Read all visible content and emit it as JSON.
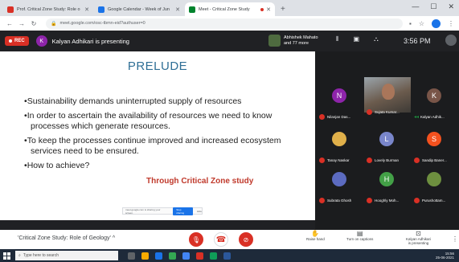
{
  "browser": {
    "tabs": [
      {
        "label": "Prof. Critical Zone Study: Role o",
        "favicon_color": "#d93025",
        "active": false
      },
      {
        "label": "Google Calendar - Week of Jun",
        "favicon_color": "#1a73e8",
        "active": false
      },
      {
        "label": "Meet - Critical Zone Study",
        "favicon_color": "#00832d",
        "active": true
      }
    ],
    "new_tab": "+",
    "url": "meet.google.com/osc-tbmn-eid?authuser=0",
    "window_controls": [
      "—",
      "☐",
      "✕"
    ]
  },
  "meet_bar": {
    "rec_label": "REC",
    "presenter_initial": "K",
    "presenting_text": "Kalyan Adhikari is presenting",
    "participants_line1": "Abhishek Mahato",
    "participants_line2": "and 77 more",
    "time": "3:56 PM",
    "you_label": "You"
  },
  "slide": {
    "title": "PRELUDE",
    "bullets": [
      "Sustainability demands uninterrupted supply of resources",
      "In order to ascertain the availability of resources we need to know processes which generate resources.",
      "To keep the processes continue improved and increased ecosystem services need to be ensured.",
      "How to achieve?"
    ],
    "subtitle": "Through Critical Zone study",
    "share_notice": "meet.google.com is sharing your screen.",
    "share_stop": "Stop sharing",
    "share_hide": "Hide"
  },
  "tiles": [
    {
      "name": "Nilanjan Das...",
      "initial": "N",
      "color": "#8e24aa",
      "video": false,
      "muted": true
    },
    {
      "name": "Sujata Kumar...",
      "initial": "",
      "color": "",
      "video": true,
      "muted": true
    },
    {
      "name": "Kalyan Adhik...",
      "initial": "K",
      "color": "#795548",
      "video": false,
      "muted": false
    },
    {
      "name": "Tanay Naskar",
      "initial": "",
      "color": "#e0b04a",
      "video": false,
      "muted": true
    },
    {
      "name": "Lovely Burman",
      "initial": "L",
      "color": "#7986cb",
      "video": false,
      "muted": true
    },
    {
      "name": "Sandip Baner...",
      "initial": "S",
      "color": "#f4511e",
      "video": false,
      "muted": true
    },
    {
      "name": "Subrata Ghosh",
      "initial": "",
      "color": "#5c6bc0",
      "video": false,
      "muted": true
    },
    {
      "name": "Hooghly Moh...",
      "initial": "H",
      "color": "#43a047",
      "video": false,
      "muted": true
    },
    {
      "name": "Purushottam...",
      "initial": "",
      "color": "#6d8f3f",
      "video": false,
      "muted": true
    }
  ],
  "controls": {
    "meeting_name": "'Critical Zone Study: Role of Geology'",
    "meeting_caret": "^",
    "raise_hand": "Raise hand",
    "captions": "Turn on captions",
    "presenting_line1": "Kalyan Adhikari",
    "presenting_line2": "is presenting",
    "more": "⋮"
  },
  "taskbar": {
    "search_placeholder": "Type here to search",
    "clock_time": "15:56",
    "clock_date": "25-06-2021"
  }
}
